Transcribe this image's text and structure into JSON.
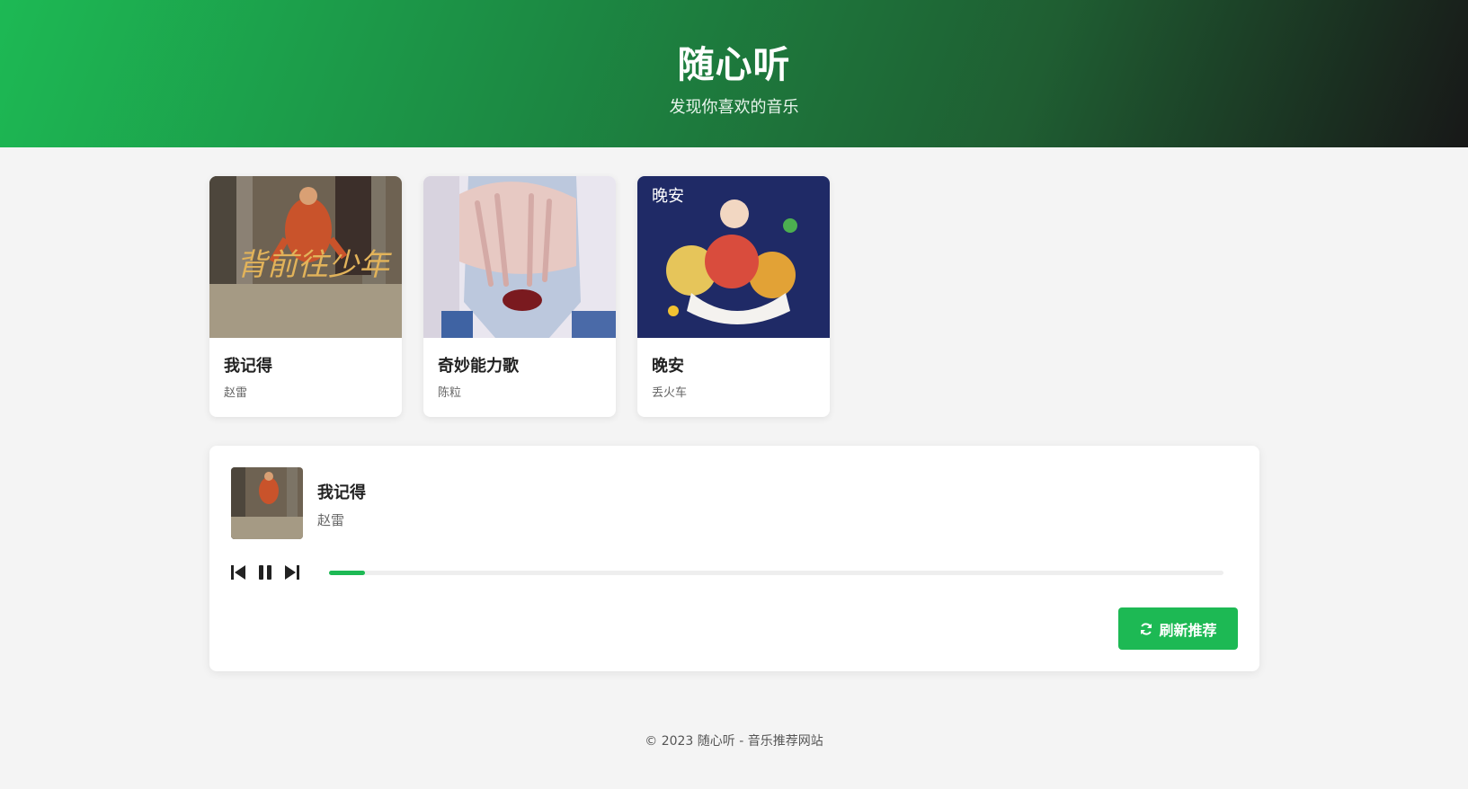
{
  "header": {
    "title": "随心听",
    "subtitle": "发现你喜欢的音乐"
  },
  "songs": [
    {
      "title": "我记得",
      "artist": "赵雷",
      "cover_text": "背前往少年",
      "icon": "album-cover-1"
    },
    {
      "title": "奇妙能力歌",
      "artist": "陈粒",
      "icon": "album-cover-2"
    },
    {
      "title": "晚安",
      "artist": "丢火车",
      "cover_text": "晚安",
      "icon": "album-cover-3"
    }
  ],
  "player": {
    "title": "我记得",
    "artist": "赵雷",
    "progress_fraction": 0.04,
    "controls": [
      "previous-icon",
      "pause-icon",
      "next-icon"
    ],
    "refresh_label": "刷新推荐"
  },
  "footer": {
    "text": "© 2023 随心听 - 音乐推荐网站"
  },
  "colors": {
    "accent": "#1db954",
    "header_dark": "#181818",
    "background": "#f4f4f4"
  }
}
